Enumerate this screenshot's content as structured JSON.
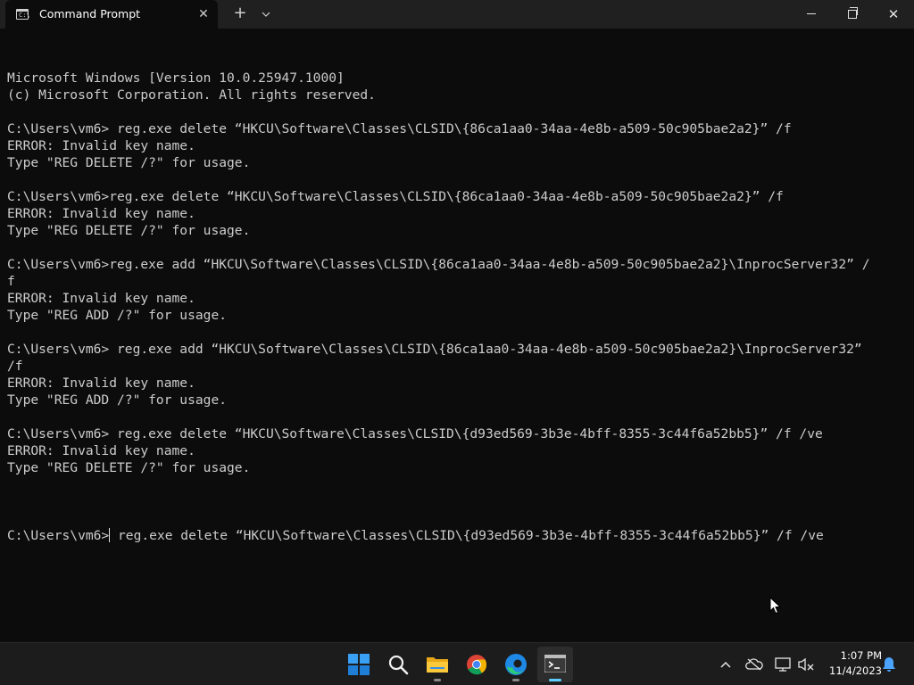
{
  "window": {
    "tab_title": "Command Prompt",
    "tab_close": "✕",
    "new_tab": "+",
    "dropdown": "⌄",
    "close": "✕"
  },
  "console": {
    "lines": [
      "Microsoft Windows [Version 10.0.25947.1000]",
      "(c) Microsoft Corporation. All rights reserved.",
      "",
      "C:\\Users\\vm6> reg.exe delete “HKCU\\Software\\Classes\\CLSID\\{86ca1aa0-34aa-4e8b-a509-50c905bae2a2}” /f",
      "ERROR: Invalid key name.",
      "Type \"REG DELETE /?\" for usage.",
      "",
      "C:\\Users\\vm6>reg.exe delete “HKCU\\Software\\Classes\\CLSID\\{86ca1aa0-34aa-4e8b-a509-50c905bae2a2}” /f",
      "ERROR: Invalid key name.",
      "Type \"REG DELETE /?\" for usage.",
      "",
      "C:\\Users\\vm6>reg.exe add “HKCU\\Software\\Classes\\CLSID\\{86ca1aa0-34aa-4e8b-a509-50c905bae2a2}\\InprocServer32” /",
      "f",
      "ERROR: Invalid key name.",
      "Type \"REG ADD /?\" for usage.",
      "",
      "C:\\Users\\vm6> reg.exe add “HKCU\\Software\\Classes\\CLSID\\{86ca1aa0-34aa-4e8b-a509-50c905bae2a2}\\InprocServer32”",
      "/f",
      "ERROR: Invalid key name.",
      "Type \"REG ADD /?\" for usage.",
      "",
      "C:\\Users\\vm6> reg.exe delete “HKCU\\Software\\Classes\\CLSID\\{d93ed569-3b3e-4bff-8355-3c44f6a52bb5}” /f /ve",
      "ERROR: Invalid key name.",
      "Type \"REG DELETE /?\" for usage.",
      ""
    ],
    "prompt": "C:\\Users\\vm6>",
    "current_input": " reg.exe delete “HKCU\\Software\\Classes\\CLSID\\{d93ed569-3b3e-4bff-8355-3c44f6a52bb5}” /f /ve"
  },
  "taskbar": {
    "apps": [
      {
        "name": "start-icon"
      },
      {
        "name": "search-icon"
      },
      {
        "name": "file-explorer-icon"
      },
      {
        "name": "chrome-icon"
      },
      {
        "name": "edge-icon"
      },
      {
        "name": "terminal-icon"
      }
    ],
    "tray_chevron": "︿",
    "time": "1:07 PM",
    "date": "11/4/2023"
  },
  "colors": {
    "console_bg": "#0c0c0c",
    "console_fg": "#cccccc",
    "titlebar_bg": "#202020",
    "taskbar_bg": "#1c1c1c",
    "accent": "#60cdff"
  }
}
